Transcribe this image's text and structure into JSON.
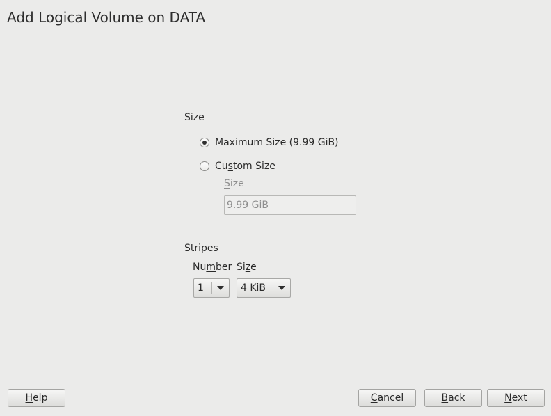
{
  "page": {
    "title": "Add Logical Volume on DATA"
  },
  "size_section": {
    "label": "Size",
    "max_option": {
      "mnemonic": "M",
      "rest": "aximum Size (9.99 GiB)",
      "selected": true
    },
    "custom_option": {
      "before": "Cu",
      "mnemonic": "s",
      "rest": "tom Size",
      "selected": false
    },
    "custom_size_label": {
      "mnemonic": "S",
      "rest": "ize"
    },
    "custom_size_value": "9.99 GiB"
  },
  "stripes_section": {
    "label": "Stripes",
    "number_label": {
      "before": "Nu",
      "mnemonic": "m",
      "rest": "ber"
    },
    "number_value": "1",
    "size_label": {
      "before": "Si",
      "mnemonic": "z",
      "rest": "e"
    },
    "size_value": "4 KiB"
  },
  "buttons": {
    "help": {
      "mnemonic": "H",
      "rest": "elp"
    },
    "cancel": {
      "mnemonic": "C",
      "rest": "ancel"
    },
    "back": {
      "mnemonic": "B",
      "rest": "ack"
    },
    "next": {
      "mnemonic": "N",
      "rest": "ext"
    }
  },
  "icons": {
    "radio": "radio-button",
    "dropdown": "triangle-down-icon"
  }
}
